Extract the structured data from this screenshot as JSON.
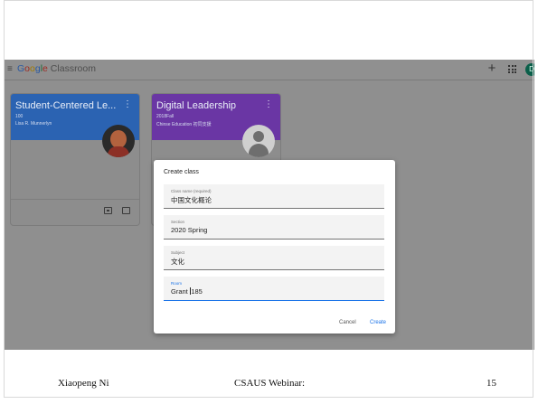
{
  "app": {
    "logo_google": [
      "G",
      "o",
      "o",
      "g",
      "l",
      "e"
    ],
    "logo_product": " Classroom",
    "user_initial": "D"
  },
  "cards": [
    {
      "title": "Student-Centered Le...",
      "section": "100",
      "teacher": "Lisa R. Munnerlyn",
      "color": "#2b63b2"
    },
    {
      "title": "Digital Leadership",
      "section": "2018Fall",
      "teacher": "Chinse Education 初同支援",
      "color": "#6a36a4"
    }
  ],
  "dialog": {
    "title": "Create class",
    "fields": [
      {
        "label": "Class name (required)",
        "value": "中国文化概论",
        "active": false
      },
      {
        "label": "Section",
        "value": "2020 Spring",
        "active": false
      },
      {
        "label": "Subject",
        "value": "文化",
        "active": false
      },
      {
        "label": "Room",
        "value_before_cursor": "Grant ",
        "value_after_cursor": "185",
        "active": true
      }
    ],
    "cancel_label": "Cancel",
    "create_label": "Create",
    "accent_color": "#1a73e8"
  },
  "slide_footer": {
    "author": "Xiaopeng Ni",
    "event": "CSAUS Webinar:",
    "page_number": "15"
  }
}
